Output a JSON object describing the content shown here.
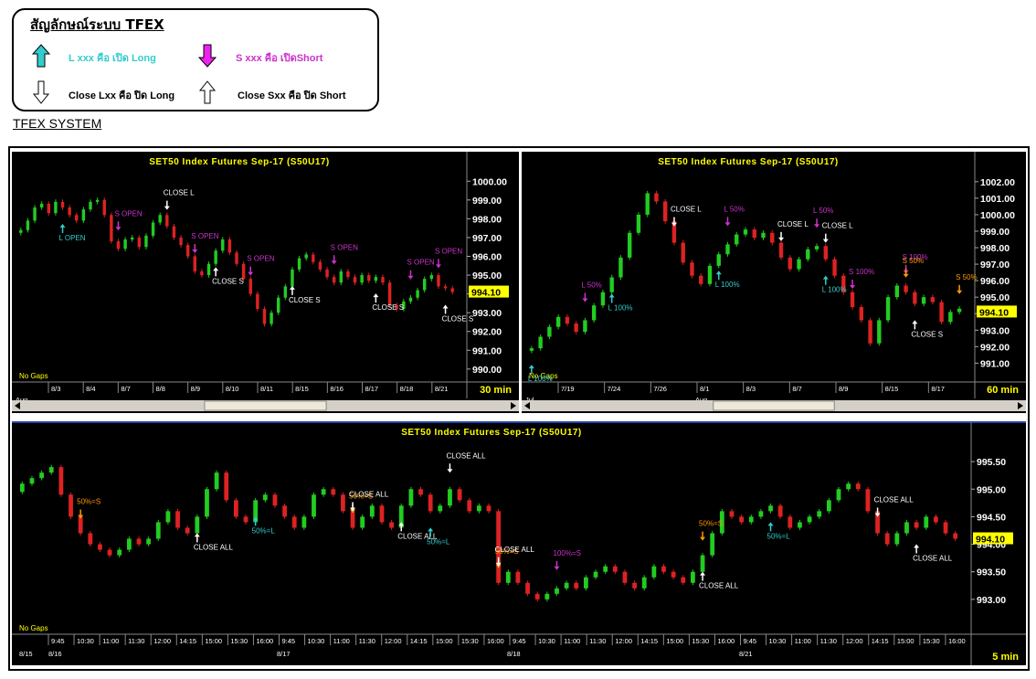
{
  "legend": {
    "title": "สัญลักษณ์ระบบ TFEX",
    "items": [
      {
        "text": "L xxx คือ เปิด Long",
        "color": "#33cccc",
        "icon": "up-arrow-cyan-icon"
      },
      {
        "text": "S xxx คือ เปิดShort",
        "color": "#cc33cc",
        "icon": "down-arrow-magenta-icon"
      },
      {
        "text": "Close Lxx คือ ปิด Long",
        "color": "#000000",
        "icon": "down-arrow-outline-icon"
      },
      {
        "text": "Close Sxx คือ ปิด Short",
        "color": "#000000",
        "icon": "up-arrow-outline-icon"
      }
    ]
  },
  "system_label": "TFEX SYSTEM",
  "colors": {
    "up": "#22cc22",
    "down": "#dd2222",
    "bg": "#000000",
    "title": "#ffff00",
    "long": "#33cccc",
    "short": "#cc33cc",
    "close": "#ffffff",
    "half": "#ff9900"
  },
  "chart_data": [
    {
      "type": "candlestick",
      "title": "SET50 Index Futures Sep-17 (S50U17)",
      "timeframe": "30 min",
      "no_gaps": "No Gaps",
      "last_price": "994.10",
      "y_ticks": [
        "1000.00",
        "999.00",
        "998.00",
        "997.00",
        "996.00",
        "995.00",
        "994.00",
        "993.00",
        "992.00",
        "991.00",
        "990.00"
      ],
      "ylim": [
        989.7,
        1000.5
      ],
      "x_ticks": [
        "8/3",
        "8/4",
        "8/7",
        "8/8",
        "8/9",
        "8/10",
        "8/11",
        "8/15",
        "8/16",
        "8/17",
        "8/18",
        "8/21"
      ],
      "x_month": "Aug",
      "path": [
        997.4,
        997.9,
        998.6,
        998.8,
        998.3,
        998.9,
        998.6,
        998.2,
        997.9,
        998.5,
        998.9,
        999.0,
        998.2,
        996.8,
        996.4,
        996.9,
        997.0,
        996.5,
        997.1,
        997.8,
        998.2,
        997.6,
        997.0,
        996.6,
        996.0,
        995.2,
        995.0,
        995.6,
        996.3,
        996.9,
        996.2,
        995.6,
        994.8,
        994.0,
        993.2,
        992.4,
        993.0,
        993.8,
        994.4,
        995.3,
        995.9,
        996.1,
        995.7,
        995.3,
        994.9,
        994.6,
        995.2,
        994.9,
        994.6,
        995.0,
        994.7,
        994.9,
        994.6,
        993.4,
        993.2,
        993.6,
        993.8,
        994.2,
        994.8,
        995.0,
        994.4,
        994.3,
        994.1
      ],
      "annotations": [
        {
          "text": "S OPEN",
          "i": 14,
          "kind": "short"
        },
        {
          "text": "L OPEN",
          "i": 6,
          "kind": "long"
        },
        {
          "text": "CLOSE L",
          "i": 21,
          "kind": "close-up"
        },
        {
          "text": "S OPEN",
          "i": 25,
          "kind": "short"
        },
        {
          "text": "CLOSE S",
          "i": 28,
          "kind": "close-below"
        },
        {
          "text": "S OPEN",
          "i": 33,
          "kind": "short"
        },
        {
          "text": "CLOSE S",
          "i": 39,
          "kind": "close-below"
        },
        {
          "text": "S OPEN",
          "i": 45,
          "kind": "short"
        },
        {
          "text": "CLOSE S",
          "i": 51,
          "kind": "close-below"
        },
        {
          "text": "S OPEN",
          "i": 56,
          "kind": "short"
        },
        {
          "text": "S OPEN",
          "i": 60,
          "kind": "short"
        },
        {
          "text": "CLOSE S",
          "i": 61,
          "kind": "close-below"
        }
      ]
    },
    {
      "type": "candlestick",
      "title": "SET50 Index Futures Sep-17 (S50U17)",
      "timeframe": "60 min",
      "no_gaps": "No Gaps",
      "last_price": "994.10",
      "y_ticks": [
        "1002.00",
        "1001.00",
        "1000.00",
        "999.00",
        "998.00",
        "997.00",
        "996.00",
        "995.00",
        "994.00",
        "993.00",
        "992.00",
        "991.00"
      ],
      "ylim": [
        990.3,
        1002.6
      ],
      "x_ticks": [
        "7/19",
        "7/24",
        "7/26",
        "8/1",
        "8/3",
        "8/7",
        "8/9",
        "8/15",
        "8/17"
      ],
      "x_month": "Jul",
      "x_month2": "Aug",
      "path": [
        991.9,
        992.6,
        993.2,
        993.8,
        993.4,
        992.9,
        993.6,
        994.5,
        995.3,
        996.2,
        997.4,
        998.9,
        1000.0,
        1001.3,
        1000.8,
        999.6,
        998.3,
        997.1,
        996.3,
        995.8,
        996.9,
        997.6,
        998.2,
        998.8,
        999.1,
        998.6,
        998.9,
        998.3,
        997.4,
        996.7,
        997.3,
        997.9,
        998.1,
        997.3,
        996.3,
        995.3,
        994.4,
        993.6,
        992.2,
        993.6,
        995.0,
        995.7,
        995.3,
        994.6,
        995.0,
        994.7,
        993.5,
        994.1,
        994.3
      ],
      "annotations": [
        {
          "text": "L 100%",
          "i": 0,
          "kind": "long"
        },
        {
          "text": "L 50%",
          "i": 6,
          "kind": "short"
        },
        {
          "text": "L 100%",
          "i": 9,
          "kind": "long"
        },
        {
          "text": "CLOSE L",
          "i": 16,
          "kind": "close-up"
        },
        {
          "text": "L 50%",
          "i": 22,
          "kind": "short"
        },
        {
          "text": "L 100%",
          "i": 21,
          "kind": "long"
        },
        {
          "text": "CLOSE L",
          "i": 28,
          "kind": "close-up"
        },
        {
          "text": "L 50%",
          "i": 32,
          "kind": "short"
        },
        {
          "text": "L 100%",
          "i": 33,
          "kind": "long"
        },
        {
          "text": "CLOSE L",
          "i": 33,
          "kind": "close-up"
        },
        {
          "text": "S 100%",
          "i": 36,
          "kind": "short"
        },
        {
          "text": "S 100%",
          "i": 42,
          "kind": "short"
        },
        {
          "text": "CLOSE S",
          "i": 43,
          "kind": "close-below"
        },
        {
          "text": "S 50%",
          "i": 42,
          "kind": "half"
        },
        {
          "text": "S 50%",
          "i": 48,
          "kind": "half"
        }
      ]
    },
    {
      "type": "candlestick",
      "title": "SET50 Index Futures Sep-17 (S50U17)",
      "timeframe": "5 min",
      "no_gaps": "No Gaps",
      "last_price": "994.10",
      "y_ticks": [
        "995.50",
        "995.00",
        "994.50",
        "994.00",
        "993.50",
        "993.00"
      ],
      "ylim": [
        992.5,
        995.85
      ],
      "x_ticks": [
        "9:45",
        "10:30",
        "11:00",
        "11:30",
        "12:00",
        "14:15",
        "15:00",
        "15:30",
        "16:00",
        "9:45",
        "10:30",
        "11:00",
        "11:30",
        "12:00",
        "14:15",
        "15:00",
        "15:30",
        "16:00",
        "9:45",
        "10:30",
        "11:00",
        "11:30",
        "12:00",
        "14:15",
        "15:00",
        "15:30",
        "16:00",
        "9:45",
        "10:30",
        "11:00",
        "11:30",
        "12:00",
        "14:15",
        "15:00",
        "15:30",
        "16:00"
      ],
      "x_dates": [
        "8/15",
        "8/16",
        "8/17",
        "8/18",
        "8/21"
      ],
      "path": [
        995.1,
        995.2,
        995.3,
        995.4,
        994.9,
        994.5,
        994.2,
        994.0,
        993.9,
        993.8,
        993.9,
        994.1,
        994.0,
        994.1,
        994.4,
        994.6,
        994.3,
        994.2,
        994.5,
        995.0,
        995.3,
        994.8,
        994.5,
        994.4,
        994.8,
        994.9,
        994.7,
        994.5,
        994.3,
        994.5,
        994.9,
        995.0,
        994.9,
        994.6,
        994.3,
        994.5,
        994.7,
        994.4,
        994.3,
        994.7,
        995.0,
        994.9,
        994.6,
        994.7,
        995.0,
        994.8,
        994.6,
        994.7,
        994.6,
        993.3,
        993.5,
        993.3,
        993.1,
        993.0,
        993.1,
        993.2,
        993.3,
        993.2,
        993.4,
        993.5,
        993.6,
        993.5,
        993.3,
        993.2,
        993.4,
        993.6,
        993.5,
        993.4,
        993.3,
        993.5,
        993.8,
        994.2,
        994.6,
        994.5,
        994.4,
        994.5,
        994.6,
        994.7,
        994.5,
        994.3,
        994.4,
        994.5,
        994.6,
        994.8,
        995.0,
        995.1,
        995.0,
        994.6,
        994.2,
        994.0,
        994.2,
        994.4,
        994.3,
        994.5,
        994.4,
        994.2,
        994.1
      ],
      "annotations": [
        {
          "text": "50%=S",
          "i": 6,
          "kind": "half"
        },
        {
          "text": "CLOSE ALL",
          "i": 18,
          "kind": "close-below"
        },
        {
          "text": "50%=L",
          "i": 24,
          "kind": "long"
        },
        {
          "text": "50%=S",
          "i": 34,
          "kind": "half"
        },
        {
          "text": "CLOSE ALL",
          "i": 34,
          "kind": "close-up"
        },
        {
          "text": "CLOSE ALL",
          "i": 39,
          "kind": "close-below"
        },
        {
          "text": "50%=L",
          "i": 42,
          "kind": "long"
        },
        {
          "text": "CLOSE ALL",
          "i": 44,
          "kind": "close-up"
        },
        {
          "text": "50%=S",
          "i": 49,
          "kind": "half"
        },
        {
          "text": "CLOSE ALL",
          "i": 49,
          "kind": "close-up"
        },
        {
          "text": "100%=S",
          "i": 55,
          "kind": "short"
        },
        {
          "text": "CLOSE ALL",
          "i": 70,
          "kind": "close-below"
        },
        {
          "text": "50%=S",
          "i": 70,
          "kind": "half"
        },
        {
          "text": "50%=L",
          "i": 77,
          "kind": "long"
        },
        {
          "text": "CLOSE ALL",
          "i": 88,
          "kind": "close-up"
        },
        {
          "text": "CLOSE ALL",
          "i": 92,
          "kind": "close-below"
        }
      ]
    }
  ]
}
